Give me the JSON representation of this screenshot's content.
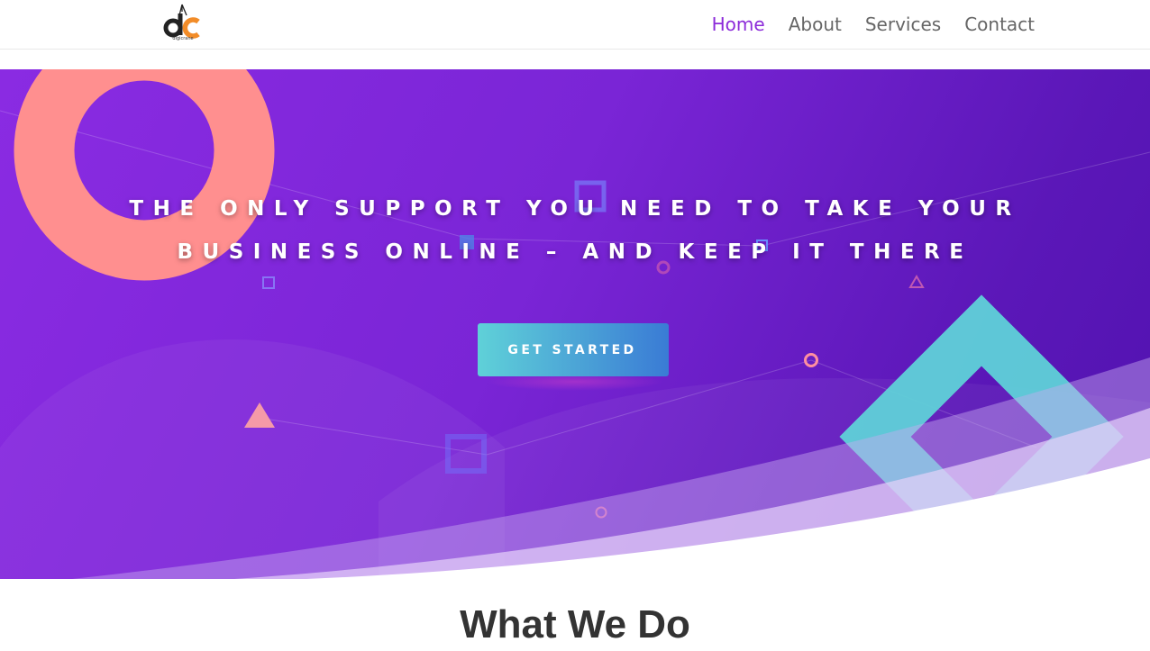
{
  "colors": {
    "brand_purple": "#8c2bd9",
    "nav_text": "#666666",
    "hero_gradient_start": "#8a2be2",
    "hero_gradient_end": "#5112b0",
    "cta_gradient_start": "#5fd1d8",
    "cta_gradient_end": "#3a7bd5",
    "ring_pink": "#ff8f8f",
    "diamond_teal": "#5fd1d8"
  },
  "header": {
    "logo": {
      "icon": "crane-logo-icon",
      "letters": "dC",
      "tagline": "digicrane"
    },
    "nav": [
      {
        "label": "Home",
        "active": true
      },
      {
        "label": "About",
        "active": false
      },
      {
        "label": "Services",
        "active": false
      },
      {
        "label": "Contact",
        "active": false
      }
    ]
  },
  "hero": {
    "headline_line1": "THE ONLY SUPPORT YOU NEED TO TAKE YOUR",
    "headline_line2": "BUSINESS ONLINE – AND KEEP IT THERE",
    "cta_label": "GET STARTED"
  },
  "section": {
    "title": "What We Do"
  }
}
